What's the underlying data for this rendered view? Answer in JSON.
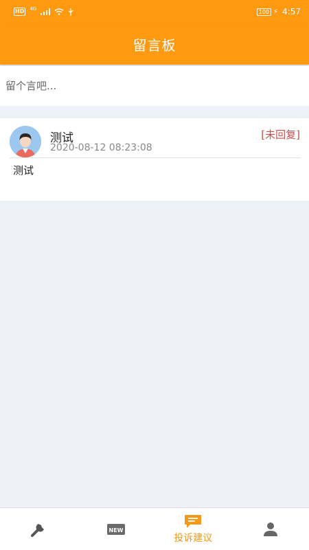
{
  "status_bar": {
    "left_badge": "HD",
    "network": "4G",
    "battery": "100",
    "time": "4:57"
  },
  "header": {
    "title": "留言板"
  },
  "compose": {
    "placeholder": "留个言吧..."
  },
  "messages": [
    {
      "author": "测试",
      "datetime": "2020-08-12 08:23:08",
      "status": "[未回复]",
      "content": "测试"
    }
  ],
  "tabbar": {
    "active_color": "#f39a1d",
    "inactive_color": "#555555",
    "tabs": [
      {
        "icon": "wrench-icon",
        "label": ""
      },
      {
        "icon": "new-badge-icon",
        "label": "NEW"
      },
      {
        "icon": "chat-icon",
        "label": "投诉建议",
        "active": true
      },
      {
        "icon": "person-icon",
        "label": ""
      }
    ]
  },
  "colors": {
    "brand": "#fd9a10",
    "background": "#eef1f8",
    "status_unreplied": "#c0504d"
  }
}
